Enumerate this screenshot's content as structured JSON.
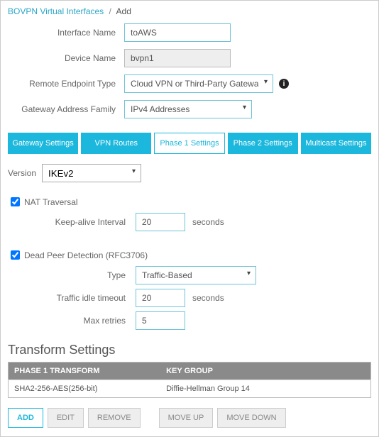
{
  "breadcrumb": {
    "parent": "BOVPN Virtual Interfaces",
    "current": "Add"
  },
  "form": {
    "interface_name_label": "Interface Name",
    "interface_name_value": "toAWS",
    "device_name_label": "Device Name",
    "device_name_value": "bvpn1",
    "remote_endpoint_label": "Remote Endpoint Type",
    "remote_endpoint_value": "Cloud VPN or Third-Party Gateway",
    "gateway_family_label": "Gateway Address Family",
    "gateway_family_value": "IPv4 Addresses"
  },
  "tabs": {
    "t0": "Gateway Settings",
    "t1": "VPN Routes",
    "t2": "Phase 1 Settings",
    "t3": "Phase 2 Settings",
    "t4": "Multicast Settings"
  },
  "phase1": {
    "version_label": "Version",
    "version_value": "IKEv2",
    "nat_label": "NAT Traversal",
    "nat_checked": true,
    "keepalive_label": "Keep-alive Interval",
    "keepalive_value": "20",
    "seconds": "seconds",
    "dpd_label": "Dead Peer Detection (RFC3706)",
    "dpd_checked": true,
    "type_label": "Type",
    "type_value": "Traffic-Based",
    "idle_label": "Traffic idle timeout",
    "idle_value": "20",
    "retries_label": "Max retries",
    "retries_value": "5"
  },
  "transform": {
    "heading": "Transform Settings",
    "col1": "PHASE 1 TRANSFORM",
    "col2": "KEY GROUP",
    "row1c1": "SHA2-256-AES(256-bit)",
    "row1c2": "Diffie-Hellman Group 14"
  },
  "buttons": {
    "add": "ADD",
    "edit": "EDIT",
    "remove": "REMOVE",
    "moveup": "MOVE UP",
    "movedown": "MOVE DOWN"
  }
}
